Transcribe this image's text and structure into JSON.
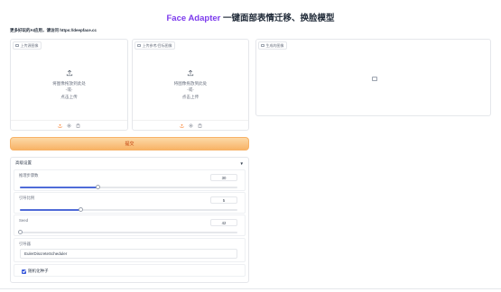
{
  "header": {
    "brand": "Face Adapter",
    "title_rest": " 一键面部表情迁移、换脸模型"
  },
  "notice": "更多好玩的AI应用，请访问 https://deepface.cc",
  "source_panel": {
    "label": "上传源图像",
    "drop_line1": "将图像拖放到此处",
    "drop_line2": "-或-",
    "drop_line3": "点击上传"
  },
  "target_panel": {
    "label": "上传参考/目标图像",
    "drop_line1": "将图像拖放到此处",
    "drop_line2": "-或-",
    "drop_line3": "点击上传"
  },
  "output_panel": {
    "label": "生成的图像"
  },
  "submit_label": "提交",
  "advanced": {
    "title": "高级设置",
    "toggle_icon": "▼",
    "steps": {
      "label": "推理步骤数",
      "value": "30",
      "fraction": 0.36
    },
    "guidance": {
      "label": "引导比例",
      "value": "5",
      "fraction": 0.28
    },
    "seed": {
      "label": "Seed",
      "value": "42",
      "fraction": 0.0
    },
    "scheduler": {
      "label": "引导器",
      "value": "EulerDiscreteScheduler"
    },
    "random_seed": {
      "label": "随机化种子",
      "checked": true
    }
  },
  "colors": {
    "brand": "#7c3aed",
    "submit_orange": "#f8b366",
    "slider_fill": "#4f6bd8",
    "upload_icon": "#f97316"
  }
}
